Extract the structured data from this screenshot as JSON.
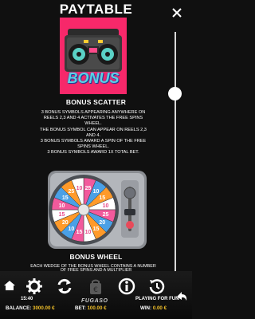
{
  "header": {
    "title": "PAYTABLE"
  },
  "bonus_image": {
    "label": "BONUS"
  },
  "bonus_scatter": {
    "title": "BONUS SCATTER",
    "lines": [
      "3 BONUS SYMBOLS APPEARING ANYWHERE ON",
      "REELS 2,3 AND 4 ACTIVATES THE FREE SPINS",
      "WHEEL.",
      "THE BONUS SYMBOL CAN APPEAR ON REELS 2,3",
      "AND 4.",
      "3 BONUS SYMBOLS AWARD A SPIN OF THE FREE",
      "SPINS WHEEL.",
      "3 BONUS SYMBOLS AWARD 1X TOTAL BET."
    ]
  },
  "bonus_wheel": {
    "title": "BONUS WHEEL",
    "line": "EACH WEDGE OF THE BONUS WHEEL CONTAINS A NUMBER",
    "segments": [
      "25",
      "10",
      "15",
      "10",
      "25",
      "20",
      "15",
      "10",
      "15",
      "10",
      "20",
      "15",
      "10",
      "15",
      "25",
      "10"
    ]
  },
  "toolbar": {
    "info_text": "OF FREE SPINS AND A MULTIPLIER",
    "time": "15:40",
    "brand": "FUGASO",
    "mode": "PLAYING FOR FUN",
    "balance_label": "BALANCE:",
    "balance_value": "3000.00 €",
    "bet_label": "BET:",
    "bet_value": "100.00 €",
    "win_label": "WIN:",
    "win_value": "0.00 €"
  },
  "colors": {
    "accent": "#f4c22a",
    "bonus_bg": "#f7286a",
    "wheel_pink": "#f25a9c",
    "wheel_blue": "#4aa0e6",
    "wheel_orange": "#ff9a2a"
  }
}
